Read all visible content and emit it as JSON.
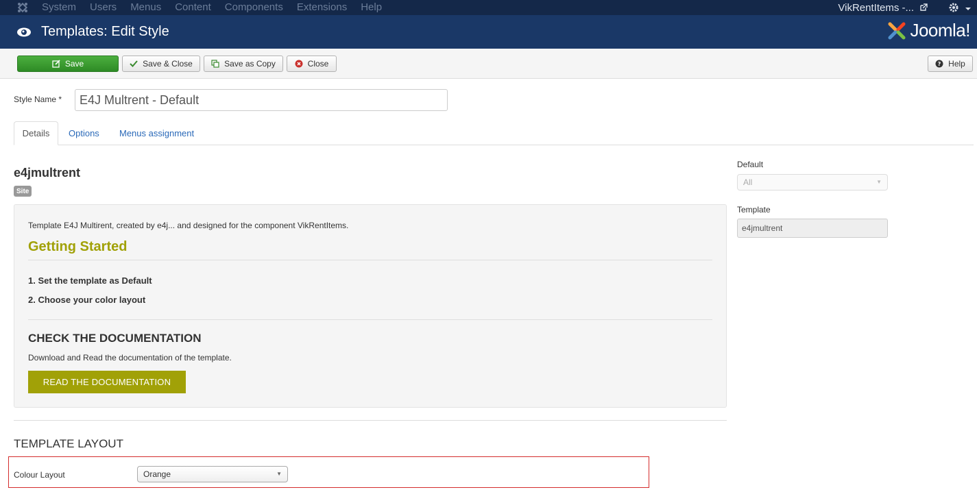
{
  "topbar": {
    "menu": [
      "System",
      "Users",
      "Menus",
      "Content",
      "Components",
      "Extensions",
      "Help"
    ],
    "site_link": "VikRentItems -..."
  },
  "header": {
    "title": "Templates: Edit Style",
    "brand": "Joomla!"
  },
  "toolbar": {
    "save": "Save",
    "save_close": "Save & Close",
    "save_copy": "Save as Copy",
    "close": "Close",
    "help": "Help"
  },
  "form": {
    "style_name_label": "Style Name *",
    "style_name_value": "E4J Multrent - Default"
  },
  "tabs": [
    "Details",
    "Options",
    "Menus assignment"
  ],
  "details": {
    "template_name": "e4jmultrent",
    "badge": "Site",
    "description": "Template E4J Multirent, created by e4j... and designed for the component VikRentItems.",
    "getting_started": "Getting Started",
    "step1": "1. Set the template as Default",
    "step2": "2. Choose your color layout",
    "doc_title": "CHECK THE DOCUMENTATION",
    "doc_desc": "Download and Read the documentation of the template.",
    "doc_button": "READ THE DOCUMENTATION",
    "layout_title": "TEMPLATE LAYOUT",
    "colour_label": "Colour Layout",
    "colour_value": "Orange"
  },
  "sidebar": {
    "default_label": "Default",
    "default_value": "All",
    "template_label": "Template",
    "template_value": "e4jmultrent"
  },
  "colors": {
    "topbar": "#142849",
    "header": "#1a3867",
    "save_green": "#2e8b25",
    "accent_olive": "#a1a107",
    "highlight_red": "#d42c2c"
  }
}
